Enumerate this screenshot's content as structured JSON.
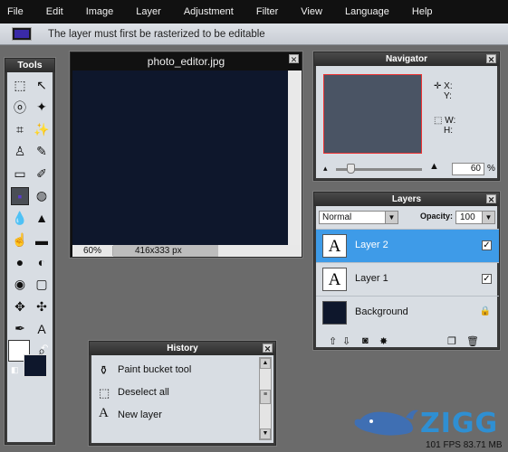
{
  "menubar": {
    "items": [
      "File",
      "Edit",
      "Image",
      "Layer",
      "Adjustment",
      "Filter",
      "View",
      "Language",
      "Help"
    ]
  },
  "options_bar": {
    "message": "The layer must first be rasterized to be editable",
    "swatch_color": "#3a2aa8"
  },
  "tools_panel": {
    "title": "Tools",
    "tools": [
      {
        "name": "marquee-select-icon",
        "glyph": "⬚"
      },
      {
        "name": "move-icon",
        "glyph": "↖"
      },
      {
        "name": "lasso-icon",
        "glyph": "ⓞ"
      },
      {
        "name": "magic-wand-icon",
        "glyph": "✦"
      },
      {
        "name": "crop-icon",
        "glyph": "⌗"
      },
      {
        "name": "dummy-icon",
        "glyph": ""
      },
      {
        "name": "stamp-icon",
        "glyph": "♙"
      },
      {
        "name": "pencil-icon",
        "glyph": "✎"
      },
      {
        "name": "eraser-icon",
        "glyph": "▭"
      },
      {
        "name": "brush-icon",
        "glyph": "✐"
      },
      {
        "name": "paint-bucket-icon",
        "glyph": "▪"
      },
      {
        "name": "color-replace-icon",
        "glyph": "◍"
      },
      {
        "name": "blur-icon",
        "glyph": "💧"
      },
      {
        "name": "sharpen-icon",
        "glyph": "▲"
      },
      {
        "name": "smudge-icon",
        "glyph": "☝"
      },
      {
        "name": "sponge-icon",
        "glyph": "▬"
      },
      {
        "name": "burn-icon",
        "glyph": "●"
      },
      {
        "name": "dodge-icon",
        "glyph": "◐"
      },
      {
        "name": "red-eye-icon",
        "glyph": "◉"
      },
      {
        "name": "rectangle-icon",
        "glyph": "▢"
      },
      {
        "name": "bloat-icon",
        "glyph": "✥"
      },
      {
        "name": "pinch-icon",
        "glyph": "✣"
      },
      {
        "name": "color-picker-icon",
        "glyph": "✒"
      },
      {
        "name": "type-icon",
        "glyph": "A"
      },
      {
        "name": "hand-icon",
        "glyph": "✋"
      },
      {
        "name": "zoom-icon",
        "glyph": "⌕"
      }
    ],
    "foreground_color": "#ffffff",
    "background_color": "#0e172c"
  },
  "document": {
    "title": "photo_editor.jpg",
    "zoom": "60%",
    "size": "416x333 px",
    "canvas_color": "#0e172c"
  },
  "navigator": {
    "title": "Navigator",
    "x_label": "X:",
    "y_label": "Y:",
    "w_label": "W:",
    "h_label": "H:",
    "zoom_value": "60",
    "zoom_unit": "%"
  },
  "layers_panel": {
    "title": "Layers",
    "blend_mode": "Normal",
    "opacity_label": "Opacity:",
    "opacity_value": "100",
    "layers": [
      {
        "name": "Layer 2",
        "thumb": "A",
        "selected": true,
        "visible": true
      },
      {
        "name": "Layer 1",
        "thumb": "A",
        "selected": false,
        "visible": true
      },
      {
        "name": "Background",
        "thumb": "",
        "selected": false,
        "locked": true
      }
    ]
  },
  "history_panel": {
    "title": "History",
    "items": [
      {
        "icon": "paint-bucket-icon",
        "glyph": "⚱",
        "label": "Paint bucket tool"
      },
      {
        "icon": "deselect-icon",
        "glyph": "⬚",
        "label": "Deselect all"
      },
      {
        "icon": "new-layer-icon",
        "glyph": "A",
        "label": "New layer"
      }
    ]
  },
  "footer": {
    "brand": "ZIGG",
    "stats": "101 FPS 83.71 MB"
  }
}
